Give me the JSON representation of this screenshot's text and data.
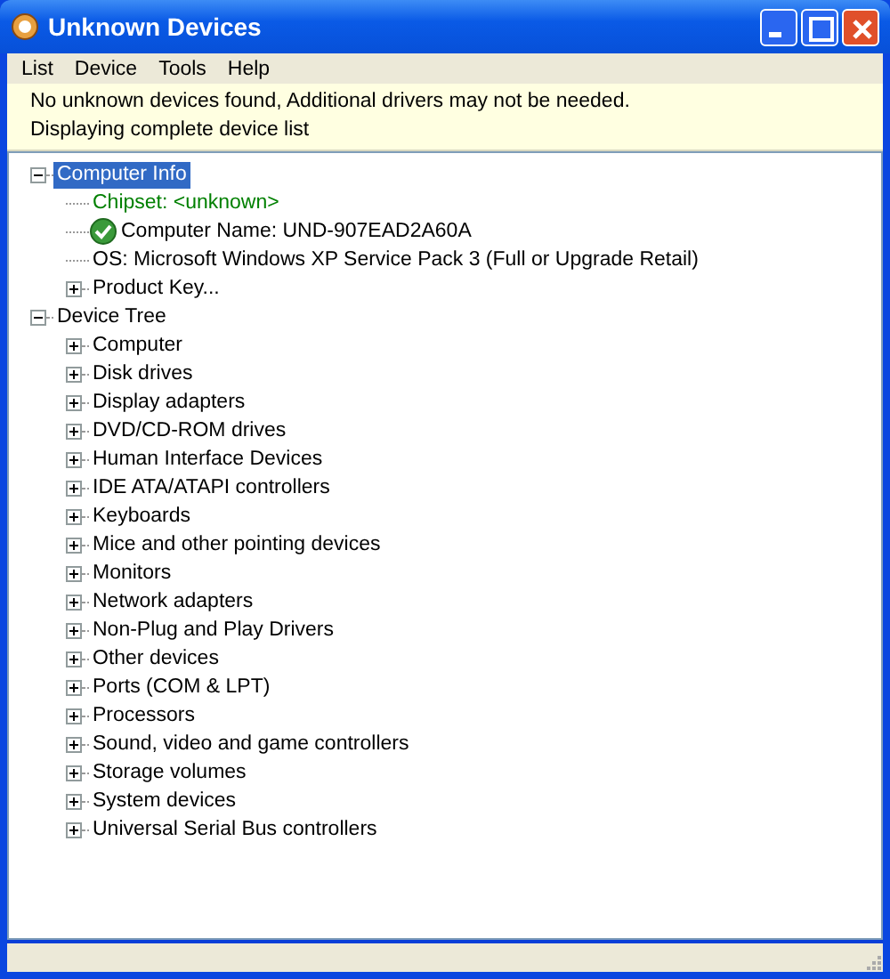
{
  "window": {
    "title": "Unknown Devices"
  },
  "menu": [
    "List",
    "Device",
    "Tools",
    "Help"
  ],
  "info": [
    "No unknown devices found, Additional drivers may not be needed.",
    "Displaying complete device list"
  ],
  "tree": [
    {
      "label": "Computer Info",
      "kind": "group",
      "expanded": true,
      "selected": true,
      "children": [
        {
          "label": "Chipset: <unknown>",
          "kind": "leaf",
          "color": "#008000",
          "selected": false
        },
        {
          "label": "Computer Name: UND-907EAD2A60A",
          "kind": "verified",
          "selected": false
        },
        {
          "label": "OS: Microsoft Windows XP Service Pack 3 (Full or Upgrade Retail)",
          "kind": "leaf",
          "selected": false
        },
        {
          "label": "Product Key...",
          "kind": "group",
          "expanded": false,
          "selected": false
        }
      ]
    },
    {
      "label": "Device Tree",
      "kind": "group",
      "expanded": true,
      "selected": false,
      "children": [
        {
          "label": "Computer",
          "kind": "group",
          "expanded": false,
          "selected": false
        },
        {
          "label": "Disk drives",
          "kind": "group",
          "expanded": false,
          "selected": false
        },
        {
          "label": "Display adapters",
          "kind": "group",
          "expanded": false,
          "selected": false
        },
        {
          "label": "DVD/CD-ROM drives",
          "kind": "group",
          "expanded": false,
          "selected": false
        },
        {
          "label": "Human Interface Devices",
          "kind": "group",
          "expanded": false,
          "selected": false
        },
        {
          "label": "IDE ATA/ATAPI controllers",
          "kind": "group",
          "expanded": false,
          "selected": false
        },
        {
          "label": "Keyboards",
          "kind": "group",
          "expanded": false,
          "selected": false
        },
        {
          "label": "Mice and other pointing devices",
          "kind": "group",
          "expanded": false,
          "selected": false
        },
        {
          "label": "Monitors",
          "kind": "group",
          "expanded": false,
          "selected": false
        },
        {
          "label": "Network adapters",
          "kind": "group",
          "expanded": false,
          "selected": false
        },
        {
          "label": "Non-Plug and Play Drivers",
          "kind": "group",
          "expanded": false,
          "selected": false
        },
        {
          "label": "Other devices",
          "kind": "group",
          "expanded": false,
          "selected": false
        },
        {
          "label": "Ports (COM & LPT)",
          "kind": "group",
          "expanded": false,
          "selected": false
        },
        {
          "label": "Processors",
          "kind": "group",
          "expanded": false,
          "selected": false
        },
        {
          "label": "Sound, video and game controllers",
          "kind": "group",
          "expanded": false,
          "selected": false
        },
        {
          "label": "Storage volumes",
          "kind": "group",
          "expanded": false,
          "selected": false
        },
        {
          "label": "System devices",
          "kind": "group",
          "expanded": false,
          "selected": false
        },
        {
          "label": "Universal Serial Bus controllers",
          "kind": "group",
          "expanded": false,
          "selected": false
        }
      ]
    }
  ]
}
